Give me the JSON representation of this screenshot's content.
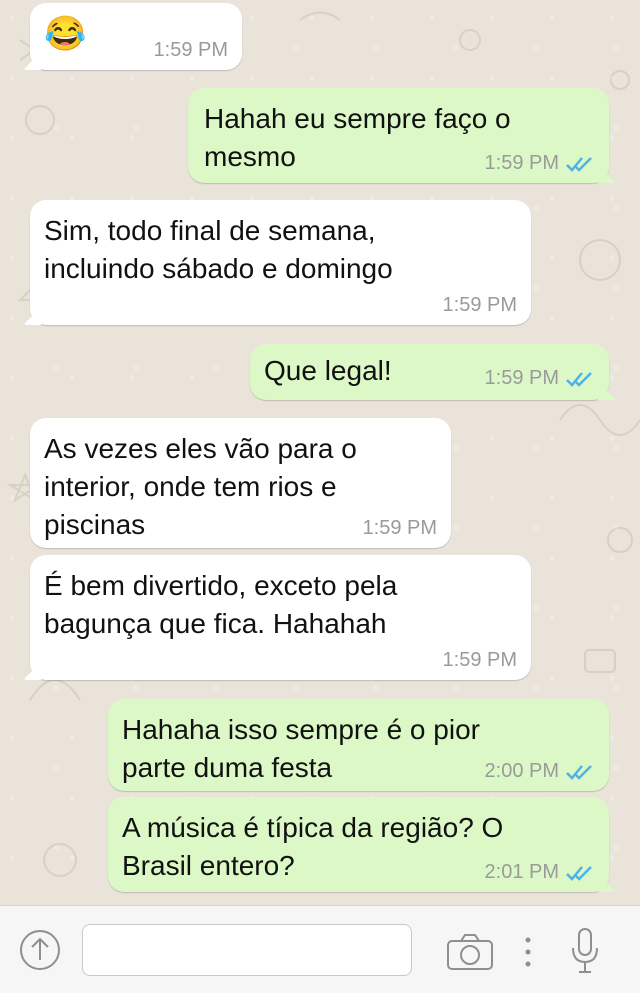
{
  "messages": [
    {
      "id": "m1",
      "dir": "in",
      "emoji": "😂",
      "time": "1:59 PM"
    },
    {
      "id": "m2",
      "dir": "out",
      "text": "Hahah eu sempre faço o\nmesmo",
      "time": "1:59 PM",
      "status": "read"
    },
    {
      "id": "m3",
      "dir": "in",
      "text": "Sim, todo final de semana,\nincluindo sábado e domingo",
      "time": "1:59 PM"
    },
    {
      "id": "m4",
      "dir": "out",
      "text": "Que legal!",
      "time": "1:59 PM",
      "status": "read"
    },
    {
      "id": "m5",
      "dir": "in",
      "text": "As vezes eles vão para o\ninterior, onde tem rios e\npiscinas",
      "time": "1:59 PM"
    },
    {
      "id": "m6",
      "dir": "in",
      "text": "É bem divertido, exceto pela\nbagunça que fica. Hahahah",
      "time": "1:59 PM"
    },
    {
      "id": "m7",
      "dir": "out",
      "text": "Hahaha isso sempre é o pior\nparte duma festa",
      "time": "2:00 PM",
      "status": "read"
    },
    {
      "id": "m8",
      "dir": "out",
      "text": "A música é típica da região? O\nBrasil entero?",
      "time": "2:01 PM",
      "status": "read"
    }
  ],
  "input_bar": {
    "placeholder": "",
    "icons": [
      "upload-icon",
      "camera-icon",
      "more-icon",
      "microphone-icon"
    ]
  },
  "colors": {
    "incoming": "#ffffff",
    "outgoing": "#dcf8c6",
    "read_check": "#4fb2e8",
    "background": "#e9e3d9"
  }
}
